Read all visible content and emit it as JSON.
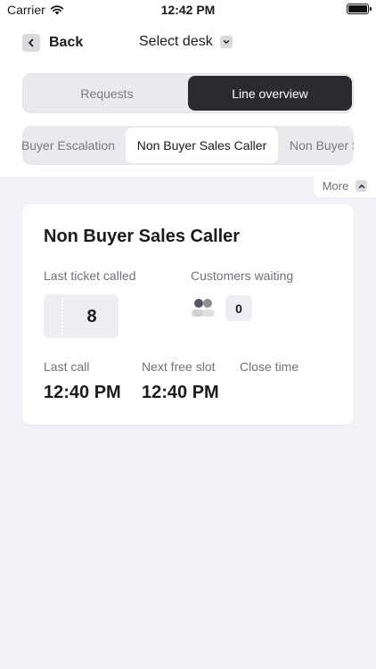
{
  "status_bar": {
    "carrier": "Carrier",
    "time": "12:42 PM",
    "battery_level": 1.0
  },
  "nav": {
    "back_label": "Back",
    "back_icon": "chevron-left-icon",
    "select_desk_label": "Select desk",
    "select_desk_icon": "chevron-down-icon"
  },
  "segments": [
    {
      "label": "Requests",
      "selected": false
    },
    {
      "label": "Line overview",
      "selected": true
    }
  ],
  "line_tabs": [
    {
      "label": "Buyer Escalation",
      "selected": false
    },
    {
      "label": "Non Buyer Sales Caller",
      "selected": true
    },
    {
      "label": "Non Buyer Support",
      "selected": false
    }
  ],
  "more": {
    "label": "More",
    "icon": "chevron-up-icon"
  },
  "card": {
    "title": "Non Buyer Sales Caller",
    "last_ticket_label": "Last ticket called",
    "last_ticket_value": "8",
    "customers_waiting_label": "Customers waiting",
    "customers_waiting_value": "0",
    "customers_icon": "people-icon",
    "last_call_label": "Last call",
    "last_call_value": "12:40 PM",
    "next_free_slot_label": "Next free slot",
    "next_free_slot_value": "12:40 PM",
    "close_time_label": "Close time",
    "close_time_value": ""
  },
  "colors": {
    "background": "#f2f1f7",
    "accent_dark": "#2a2b31",
    "chip": "#d9d9de",
    "muted_text": "#70717a"
  }
}
